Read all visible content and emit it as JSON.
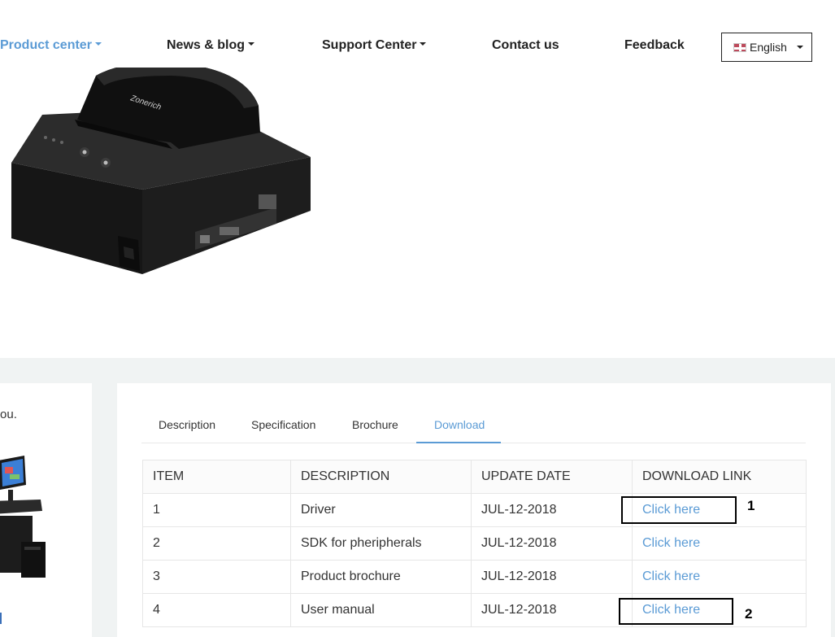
{
  "nav": {
    "items": [
      {
        "label": "Product center",
        "has_caret": true,
        "active": true
      },
      {
        "label": "News & blog",
        "has_caret": true
      },
      {
        "label": "Support Center",
        "has_caret": true
      },
      {
        "label": "Contact us",
        "has_caret": false
      },
      {
        "label": "Feedback",
        "has_caret": false
      }
    ],
    "language": "English"
  },
  "product": {
    "brand": "Zonerich"
  },
  "side_card": {
    "snippet": "o you."
  },
  "tabs": [
    {
      "label": "Description"
    },
    {
      "label": "Specification"
    },
    {
      "label": "Brochure"
    },
    {
      "label": "Download",
      "active": true
    }
  ],
  "table": {
    "headers": [
      "ITEM",
      "DESCRIPTION",
      "UPDATE DATE",
      "DOWNLOAD LINK"
    ],
    "rows": [
      {
        "item": "1",
        "description": "Driver",
        "date": "JUL-12-2018",
        "link": "Click here"
      },
      {
        "item": "2",
        "description": "SDK for pheripherals",
        "date": "JUL-12-2018",
        "link": "Click here"
      },
      {
        "item": "3",
        "description": "Product brochure",
        "date": "JUL-12-2018",
        "link": "Click here"
      },
      {
        "item": "4",
        "description": "User manual",
        "date": "JUL-12-2018",
        "link": "Click here"
      }
    ]
  },
  "annotations": [
    {
      "number": "1"
    },
    {
      "number": "2"
    }
  ],
  "colors": {
    "accent": "#5b9bd5",
    "section_bg": "#f0f3f3",
    "text": "#333333"
  }
}
